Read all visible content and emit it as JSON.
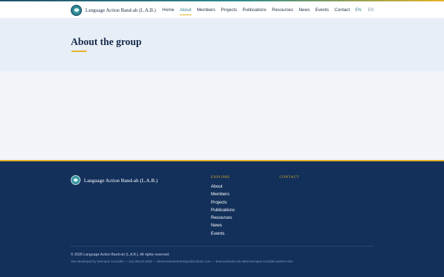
{
  "header": {
    "brand_name": "Language Action Band-ah (L.A.B.)",
    "nav": [
      {
        "label": "Home",
        "active": false
      },
      {
        "label": "About",
        "active": true
      },
      {
        "label": "Members",
        "active": false
      },
      {
        "label": "Projects",
        "active": false
      },
      {
        "label": "Publications",
        "active": false
      },
      {
        "label": "Resources",
        "active": false
      },
      {
        "label": "News",
        "active": false
      },
      {
        "label": "Events",
        "active": false
      },
      {
        "label": "Contact",
        "active": false
      }
    ],
    "languages": [
      {
        "label": "EN",
        "active": true
      },
      {
        "label": "ES",
        "active": false
      }
    ]
  },
  "main": {
    "title": "About the group"
  },
  "footer": {
    "brand_name": "Language Action Band-ah (L.A.B.)",
    "explore": {
      "heading": "Explore",
      "links": [
        "About",
        "Members",
        "Projects",
        "Publications",
        "Resources",
        "News",
        "Events"
      ]
    },
    "contact": {
      "heading": "Contact"
    },
    "copyright": "© 2026 Language Action Band-ah (L.A.B.). All rights reserved.",
    "developer": "Site developed by Henrique Corradini — (11) 99143-2030 — desenvolvedorhenrique@outlook.com — desenvolvedor-de-sites.henrique-corradini.workers.dev"
  },
  "colors": {
    "accent": "#2f7f8c",
    "highlight": "#e6b022",
    "footer_bg": "#12305a",
    "page_bg": "#f1f5fa"
  }
}
